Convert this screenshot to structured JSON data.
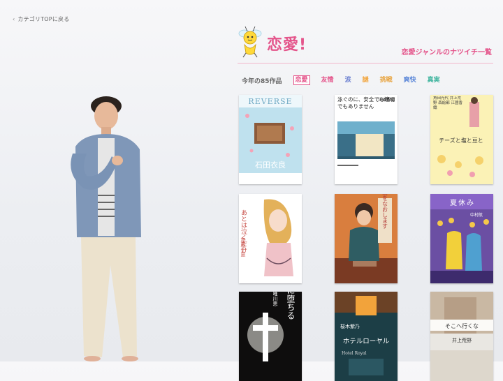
{
  "nav": {
    "back_label": "カテゴリTOPに戻る"
  },
  "header": {
    "genre_title": "恋愛!",
    "genre_subtitle": "恋愛ジャンルのナツイチ一覧"
  },
  "tabs": {
    "count_label": "今年の85作品",
    "items": [
      {
        "label": "恋愛",
        "color": "#e4558b",
        "active": true
      },
      {
        "label": "友情",
        "color": "#e4558b"
      },
      {
        "label": "涙",
        "color": "#6a7fd0"
      },
      {
        "label": "謎",
        "color": "#f2a43a"
      },
      {
        "label": "挑戦",
        "color": "#e8a33d"
      },
      {
        "label": "爽快",
        "color": "#5a86d8"
      },
      {
        "label": "真実",
        "color": "#3bb39c"
      }
    ]
  },
  "books": [
    {
      "title": "REVERSE",
      "author": "石田衣良"
    },
    {
      "title": "泳ぐのに、安全でも適切でもありません",
      "author": "江國香織"
    },
    {
      "title": "チーズと塩と豆と",
      "author": "角田光代 井上荒野 森絵都 江國香織"
    },
    {
      "title": "あとは泣くだけ",
      "author": "加藤千恵"
    },
    {
      "title": "思い出をなおします",
      "author": ""
    },
    {
      "title": "夏休み",
      "author": "中村航"
    },
    {
      "title": "天に堕ちる",
      "author": "唯川恵"
    },
    {
      "title": "ホテルローヤル",
      "author": "桜木紫乃"
    },
    {
      "title": "そこへ行くな",
      "author": "井上荒野"
    }
  ]
}
